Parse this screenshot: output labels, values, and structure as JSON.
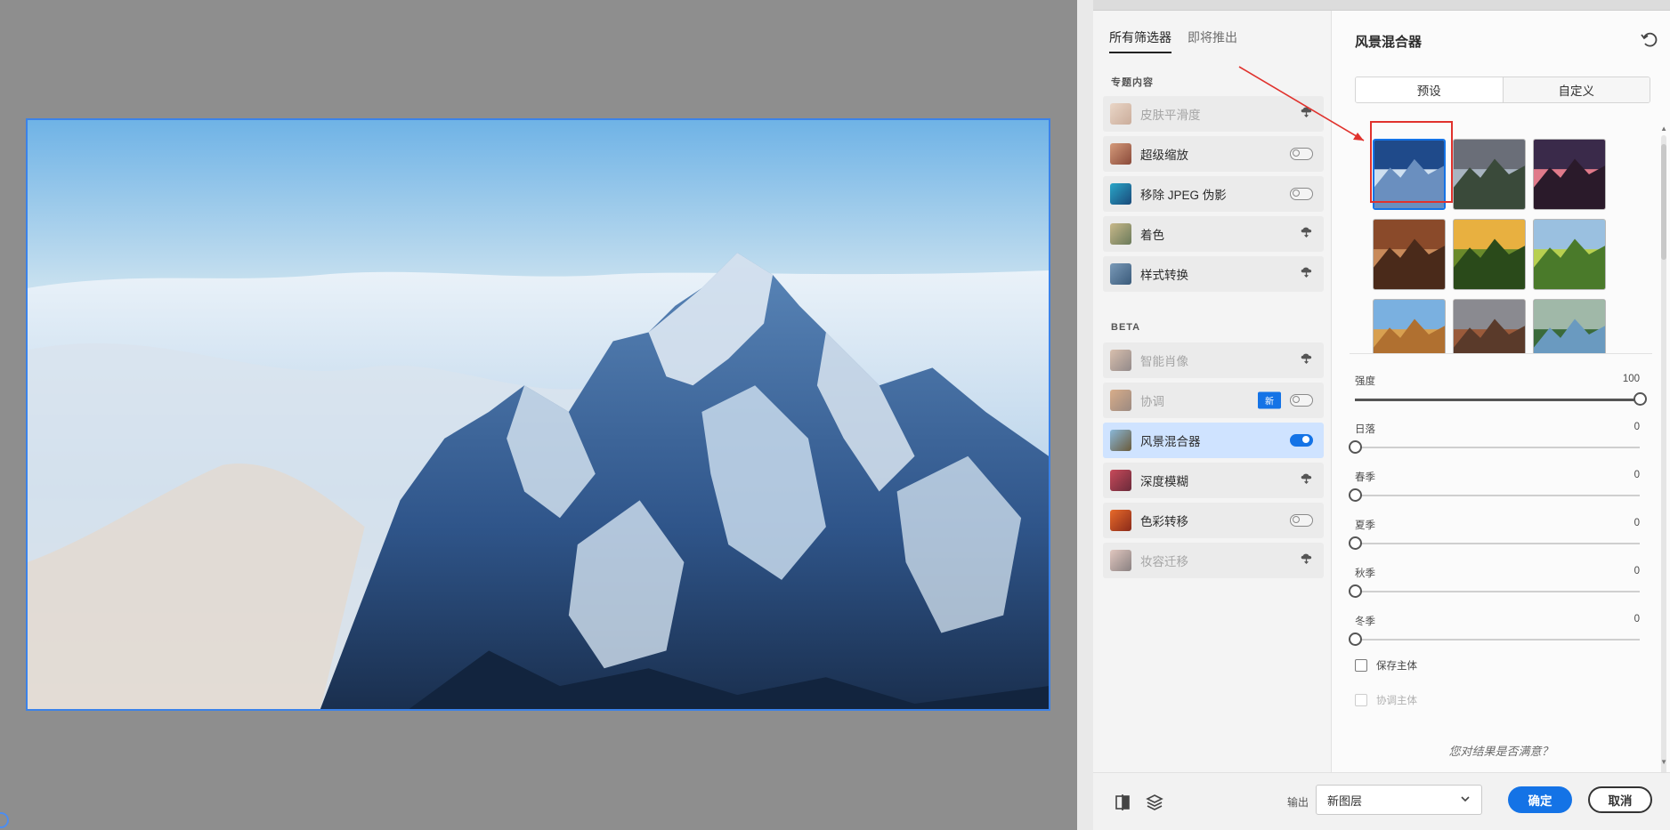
{
  "tabs": [
    {
      "label": "所有筛选器",
      "active": true
    },
    {
      "label": "即将推出",
      "active": false
    }
  ],
  "sections": {
    "featured": "专题内容",
    "beta": "BETA"
  },
  "featured_filters": [
    {
      "label": "皮肤平滑度",
      "control": "cloud-icon",
      "dim": true
    },
    {
      "label": "超级缩放",
      "control": "toggle",
      "on": false
    },
    {
      "label": "移除 JPEG 伪影",
      "control": "toggle",
      "on": false
    },
    {
      "label": "着色",
      "control": "cloud-icon"
    },
    {
      "label": "样式转换",
      "control": "cloud-icon"
    }
  ],
  "beta_filters": [
    {
      "label": "智能肖像",
      "control": "cloud-icon",
      "dim": true
    },
    {
      "label": "协调",
      "control": "toggle",
      "on": false,
      "badge": "新",
      "dim": true
    },
    {
      "label": "风景混合器",
      "control": "toggle",
      "on": true,
      "selected": true
    },
    {
      "label": "深度模糊",
      "control": "cloud-icon"
    },
    {
      "label": "色彩转移",
      "control": "toggle",
      "on": false
    },
    {
      "label": "妆容迁移",
      "control": "cloud-icon",
      "dim": true
    }
  ],
  "settings": {
    "title": "风景混合器",
    "seg_preset": "预设",
    "seg_custom": "自定义",
    "sliders": [
      {
        "label": "强度",
        "value": 100
      },
      {
        "label": "日落",
        "value": 0
      },
      {
        "label": "春季",
        "value": 0
      },
      {
        "label": "夏季",
        "value": 0
      },
      {
        "label": "秋季",
        "value": 0
      },
      {
        "label": "冬季",
        "value": 0
      }
    ],
    "checkboxes": [
      {
        "label": "保存主体",
        "checked": false,
        "dim": false
      },
      {
        "label": "协调主体",
        "checked": false,
        "dim": true
      }
    ],
    "feedback": "您对结果是否满意？"
  },
  "footer": {
    "output_label": "输出",
    "output_value": "新图层",
    "ok": "确定",
    "cancel": "取消"
  },
  "colors": {
    "accent": "#1473e6",
    "selected_row": "#cfe3ff",
    "annotation": "#e0322d"
  }
}
